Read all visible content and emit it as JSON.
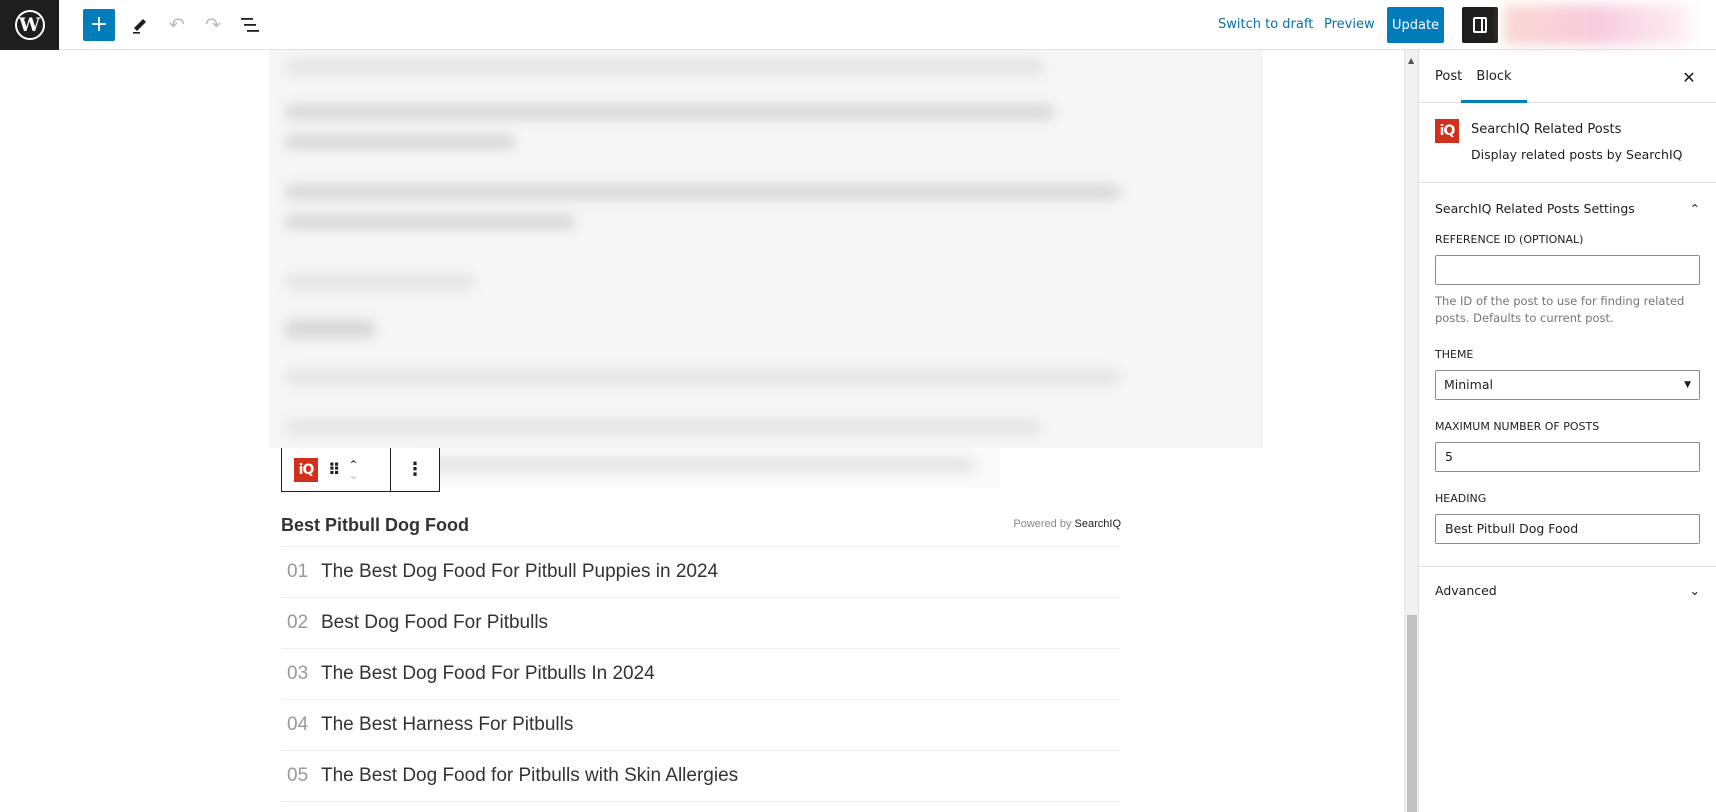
{
  "topbar": {
    "logo_label": "W",
    "add_block_icon": "+",
    "undo_icon": "↶",
    "redo_icon": "↷",
    "switch_to_draft": "Switch to draft",
    "preview": "Preview",
    "update": "Update"
  },
  "block_toolbar": {
    "block_icon": "iQ",
    "drag_icon": "⠿",
    "move_up": "⌃",
    "move_down": "⌄",
    "more_icon": "⋮"
  },
  "related_posts": {
    "heading": "Best Pitbull Dog Food",
    "powered_by_prefix": "Powered by ",
    "powered_by_brand": "SearchIQ",
    "items": [
      {
        "num": "01",
        "title": "The Best Dog Food For Pitbull Puppies in 2024"
      },
      {
        "num": "02",
        "title": "Best Dog Food For Pitbulls"
      },
      {
        "num": "03",
        "title": "The Best Dog Food For Pitbulls In 2024"
      },
      {
        "num": "04",
        "title": "The Best Harness For Pitbulls"
      },
      {
        "num": "05",
        "title": "The Best Dog Food for Pitbulls with Skin Allergies"
      }
    ]
  },
  "sidebar": {
    "tabs": [
      {
        "label": "Post"
      },
      {
        "label": "Block"
      }
    ],
    "active_tab": "Block",
    "close_icon": "✕",
    "block_card": {
      "icon": "iQ",
      "title": "SearchIQ Related Posts",
      "description": "Display related posts by SearchIQ"
    },
    "settings_panel": {
      "title": "SearchIQ Related Posts Settings",
      "toggle_icon": "⌃",
      "reference_id": {
        "label": "Reference ID (optional)",
        "value": "",
        "help": "The ID of the post to use for finding related posts. Defaults to current post."
      },
      "theme": {
        "label": "Theme",
        "value": "Minimal"
      },
      "max_posts": {
        "label": "Maximum number of posts",
        "value": "5"
      },
      "heading": {
        "label": "Heading",
        "value": "Best Pitbull Dog Food"
      }
    },
    "advanced": {
      "title": "Advanced",
      "toggle_icon": "⌄"
    }
  },
  "colors": {
    "accent": "#007cba",
    "brand_searchiq": "#d1311c",
    "dark": "#1e1e1e"
  }
}
